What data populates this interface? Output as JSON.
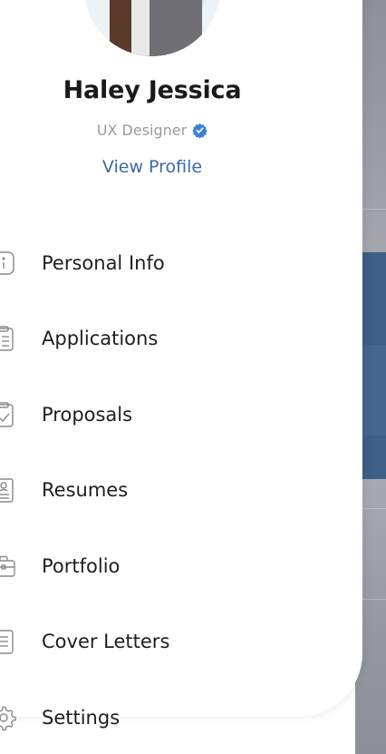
{
  "profile": {
    "name": "Haley Jessica",
    "role": "UX Designer",
    "verified_icon": "verified-badge-icon",
    "view_profile_label": "View Profile"
  },
  "menu": {
    "items": [
      {
        "label": "Personal Info",
        "icon": "info-icon"
      },
      {
        "label": "Applications",
        "icon": "clipboard-list-icon"
      },
      {
        "label": "Proposals",
        "icon": "clipboard-check-icon"
      },
      {
        "label": "Resumes",
        "icon": "resume-icon"
      },
      {
        "label": "Portfolio",
        "icon": "briefcase-icon"
      },
      {
        "label": "Cover Letters",
        "icon": "document-lines-icon"
      },
      {
        "label": "Settings",
        "icon": "gear-icon"
      }
    ]
  },
  "colors": {
    "accent": "#3d6aa6",
    "verified": "#3b82d6",
    "text": "#1e1e1e",
    "muted": "#9a9a9a",
    "icon_stroke": "#8a8a8a"
  }
}
